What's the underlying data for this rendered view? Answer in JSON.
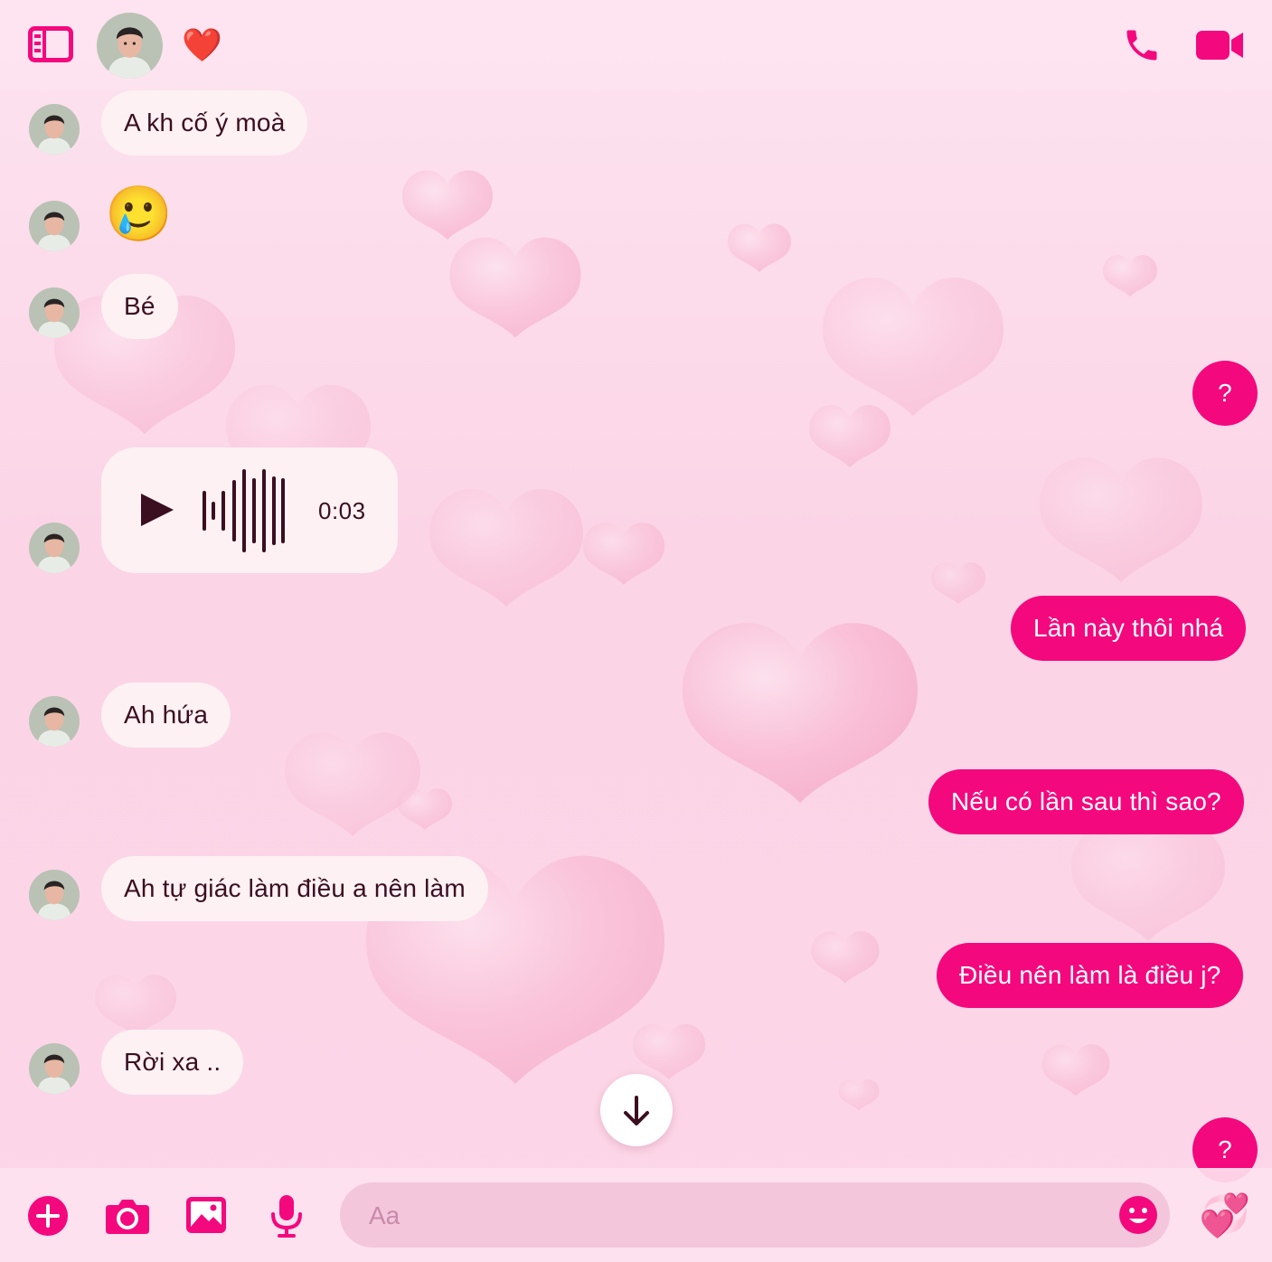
{
  "header": {
    "sidebar_icon": "sidebar-toggle-icon",
    "reaction_emoji": "❤️",
    "call_icon": "phone-icon",
    "video_icon": "video-camera-icon"
  },
  "messages": {
    "m1": "A kh cố ý moà",
    "m2_emoji": "🥲",
    "m3": "Bé",
    "m4": "?",
    "voice_duration": "0:03",
    "m6": "Lần này thôi nhá",
    "m7": "Ah hứa",
    "m8": "Nếu có lần sau thì sao?",
    "m9": "Ah tự giác làm điều a nên làm",
    "m10": "Điều nên làm là điều j?",
    "m11": "Rời xa ..",
    "m12": "?"
  },
  "composer": {
    "placeholder": "Aa",
    "send_emoji": "💞"
  },
  "icons": {
    "add": "plus-circle-icon",
    "camera": "camera-icon",
    "gallery": "image-icon",
    "mic": "microphone-icon",
    "emoji": "smiley-icon",
    "scroll": "arrow-down-icon"
  },
  "colors": {
    "accent": "#f4087e",
    "incoming_bubble": "#fdf1f3",
    "background": "#fbd4e6"
  }
}
